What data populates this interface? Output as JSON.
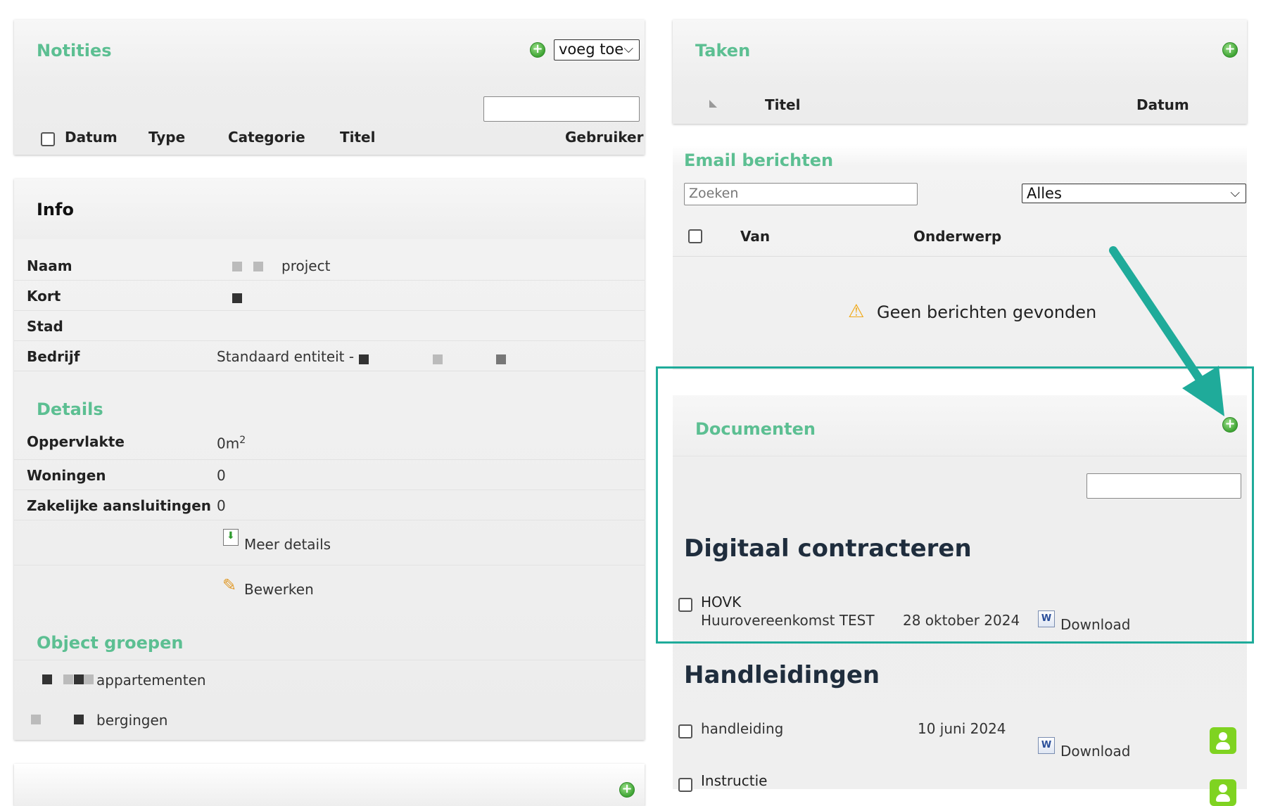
{
  "notities": {
    "title": "Notities",
    "add_select": "voeg toe",
    "columns": [
      "Datum",
      "Type",
      "Categorie",
      "Titel",
      "Gebruiker"
    ]
  },
  "info": {
    "title": "Info",
    "rows": [
      {
        "label": "Naam",
        "value": "project"
      },
      {
        "label": "Kort",
        "value": ""
      },
      {
        "label": "Stad",
        "value": ""
      },
      {
        "label": "Bedrijf",
        "value": "Standaard entiteit -"
      }
    ],
    "details_title": "Details",
    "details": [
      {
        "label": "Oppervlakte",
        "value": "0m",
        "sup": "2"
      },
      {
        "label": "Woningen",
        "value": "0"
      },
      {
        "label": "Zakelijke aansluitingen",
        "value": "0"
      }
    ],
    "meer_details": "Meer details",
    "bewerken": "Bewerken",
    "object_groepen_title": "Object groepen",
    "groepen": [
      "appartementen",
      "bergingen"
    ]
  },
  "taken": {
    "title": "Taken",
    "columns": [
      "Titel",
      "Datum"
    ]
  },
  "email": {
    "title": "Email berichten",
    "search_placeholder": "Zoeken",
    "filter": "Alles",
    "columns": [
      "Van",
      "Onderwerp"
    ],
    "empty": "Geen berichten gevonden"
  },
  "documenten": {
    "title": "Documenten",
    "groups": [
      {
        "heading": "Digitaal contracteren",
        "items": [
          {
            "name": "HOVK",
            "subtitle": "Huurovereenkomst TEST",
            "date": "28 oktober 2024",
            "download": "Download"
          }
        ]
      },
      {
        "heading": "Handleidingen",
        "items": [
          {
            "name": "handleiding",
            "date": "10 juni 2024",
            "download": "Download"
          },
          {
            "name": "Instructie"
          }
        ]
      }
    ]
  },
  "colors": {
    "accent": "#5cbf92",
    "highlight": "#1fab9a",
    "heading": "#1f2d3d"
  }
}
